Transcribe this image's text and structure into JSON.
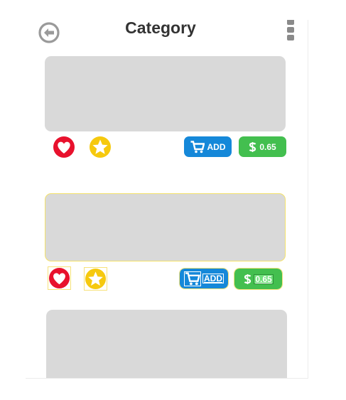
{
  "header": {
    "title": "Category",
    "back_icon": "circle-arrow-left-icon",
    "menu_icon": "vertical-dots-icon"
  },
  "products": [
    {
      "add_label": "ADD",
      "price": "0.65",
      "favorite_icon": "heart-icon",
      "rating_icon": "star-icon",
      "cart_icon": "cart-icon",
      "currency_icon": "dollar-icon"
    },
    {
      "add_label": "ADD",
      "price": "0.65",
      "favorite_icon": "heart-icon",
      "rating_icon": "star-icon",
      "cart_icon": "cart-icon",
      "currency_icon": "dollar-icon"
    },
    {}
  ],
  "colors": {
    "heart": "#e8112d",
    "star": "#f6c90e",
    "add_button": "#1588d9",
    "price_button": "#43bf4f",
    "placeholder": "#d9d9d9",
    "title": "#333333"
  }
}
